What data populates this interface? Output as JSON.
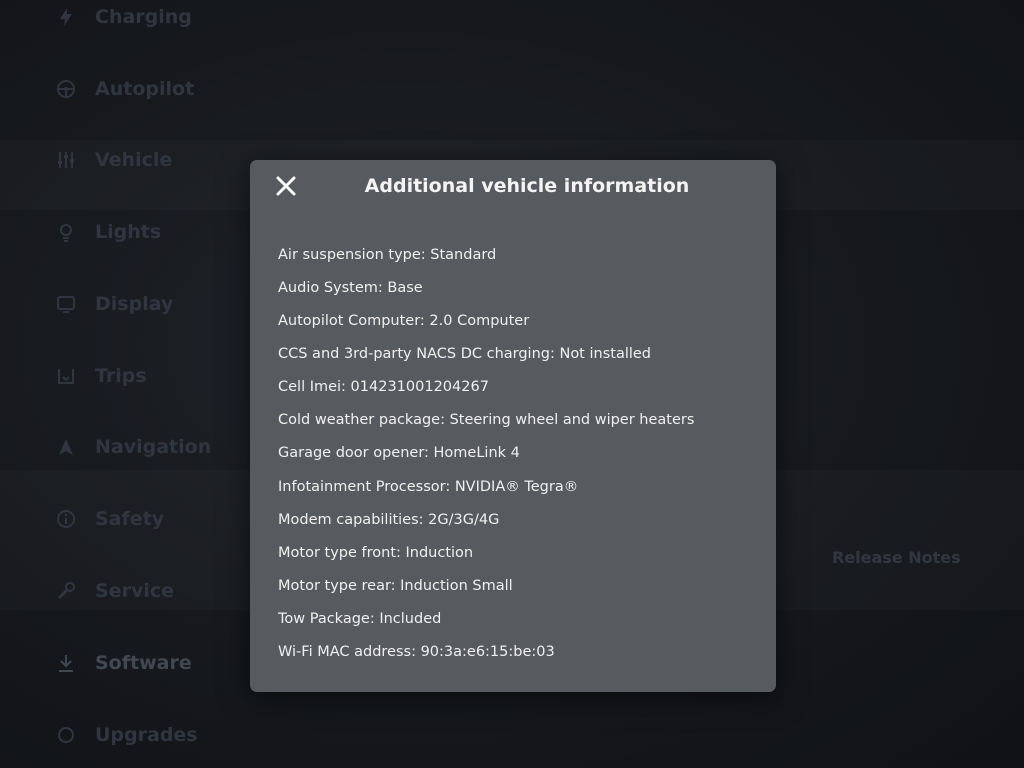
{
  "sidebar": {
    "items": [
      {
        "label": "Charging",
        "icon": "charging-icon"
      },
      {
        "label": "Autopilot",
        "icon": "steering-wheel-icon"
      },
      {
        "label": "Vehicle",
        "icon": "sliders-icon"
      },
      {
        "label": "Lights",
        "icon": "lightbulb-icon"
      },
      {
        "label": "Display",
        "icon": "display-icon"
      },
      {
        "label": "Trips",
        "icon": "trips-icon"
      },
      {
        "label": "Navigation",
        "icon": "navigation-icon"
      },
      {
        "label": "Safety",
        "icon": "info-icon"
      },
      {
        "label": "Service",
        "icon": "wrench-icon"
      },
      {
        "label": "Software",
        "icon": "download-icon"
      },
      {
        "label": "Upgrades",
        "icon": "upgrades-icon"
      }
    ],
    "active": "Software"
  },
  "software_panel": {
    "release_notes_label": "Release Notes"
  },
  "dialog": {
    "title": "Additional vehicle information",
    "close_icon": "close-icon",
    "rows": [
      "Air suspension type: Standard",
      "Audio System: Base",
      "Autopilot Computer: 2.0 Computer",
      "CCS and 3rd-party NACS DC charging: Not installed",
      "Cell Imei: 014231001204267",
      "Cold weather package: Steering wheel and wiper heaters",
      "Garage door opener: HomeLink 4",
      "Infotainment Processor: NVIDIA® Tegra®",
      "Modem capabilities: 2G/3G/4G",
      "Motor type front: Induction",
      "Motor type rear: Induction Small",
      "Tow Package: Included",
      "Wi-Fi MAC address: 90:3a:e6:15:be:03"
    ]
  },
  "colors": {
    "dialog_bg": "#575a5f",
    "text": "#f0f0f0",
    "background": "#1a1d22"
  }
}
